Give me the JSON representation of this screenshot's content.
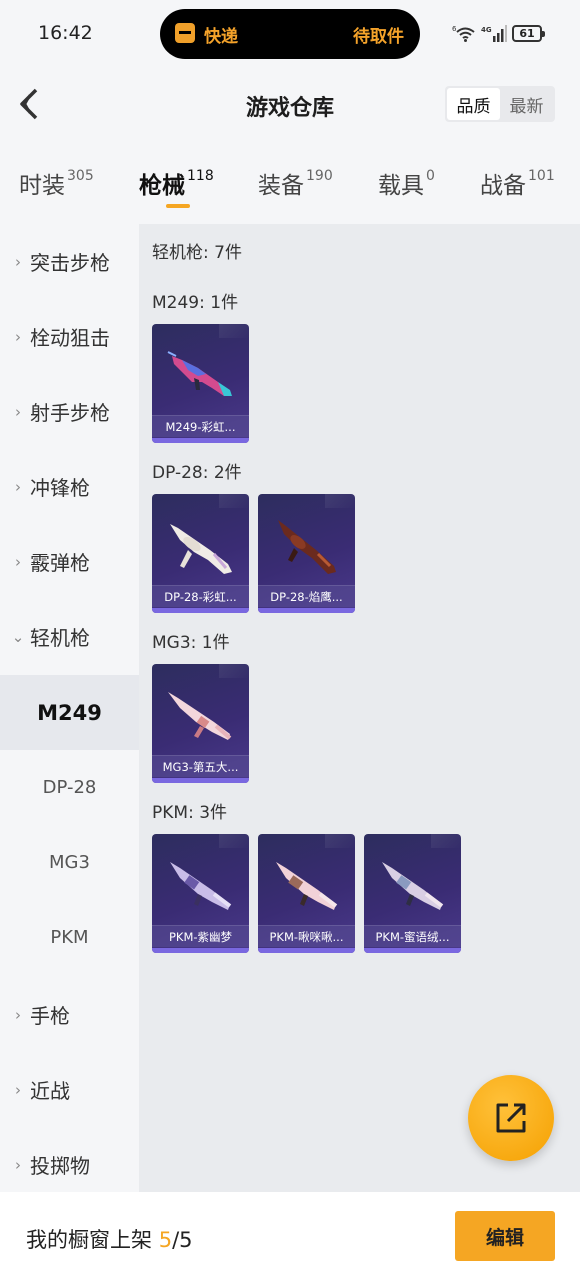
{
  "status_bar": {
    "time": "16:42",
    "island_left": "快递",
    "island_right": "待取件",
    "wifi_badge": "6",
    "network": "4G",
    "battery": "61"
  },
  "header": {
    "title": "游戏仓库",
    "sort_options": [
      "品质",
      "最新"
    ]
  },
  "tabs": [
    {
      "label": "时装",
      "count": "305"
    },
    {
      "label": "枪械",
      "count": "118"
    },
    {
      "label": "装备",
      "count": "190"
    },
    {
      "label": "载具",
      "count": "0"
    },
    {
      "label": "战备",
      "count": "101"
    }
  ],
  "sidebar": {
    "categories": [
      {
        "label": "突击步枪",
        "chevron": "›"
      },
      {
        "label": "栓动狙击",
        "chevron": "›"
      },
      {
        "label": "射手步枪",
        "chevron": "›"
      },
      {
        "label": "冲锋枪",
        "chevron": "›"
      },
      {
        "label": "霰弹枪",
        "chevron": "›"
      },
      {
        "label": "轻机枪",
        "chevron": "⌄"
      },
      {
        "label": "手枪",
        "chevron": "›"
      },
      {
        "label": "近战",
        "chevron": "›"
      },
      {
        "label": "投掷物",
        "chevron": "›"
      }
    ],
    "subitems": [
      "M249",
      "DP-28",
      "MG3",
      "PKM"
    ]
  },
  "content": {
    "summary": "轻机枪: 7件",
    "groups": [
      {
        "title": "M249: 1件",
        "items": [
          "M249-彩虹..."
        ]
      },
      {
        "title": "DP-28: 2件",
        "items": [
          "DP-28-彩虹...",
          "DP-28-焰鹰..."
        ]
      },
      {
        "title": "MG3: 1件",
        "items": [
          "MG3-第五大..."
        ]
      },
      {
        "title": "PKM: 3件",
        "items": [
          "PKM-紫幽梦",
          "PKM-啾咪啾...",
          "PKM-蜜语绒..."
        ]
      }
    ]
  },
  "bottom": {
    "label": "我的橱窗上架",
    "current": "5",
    "separator": "/5",
    "edit": "编辑"
  },
  "colors": {
    "accent": "#f5a623",
    "card_bg": "#3a2c74"
  }
}
